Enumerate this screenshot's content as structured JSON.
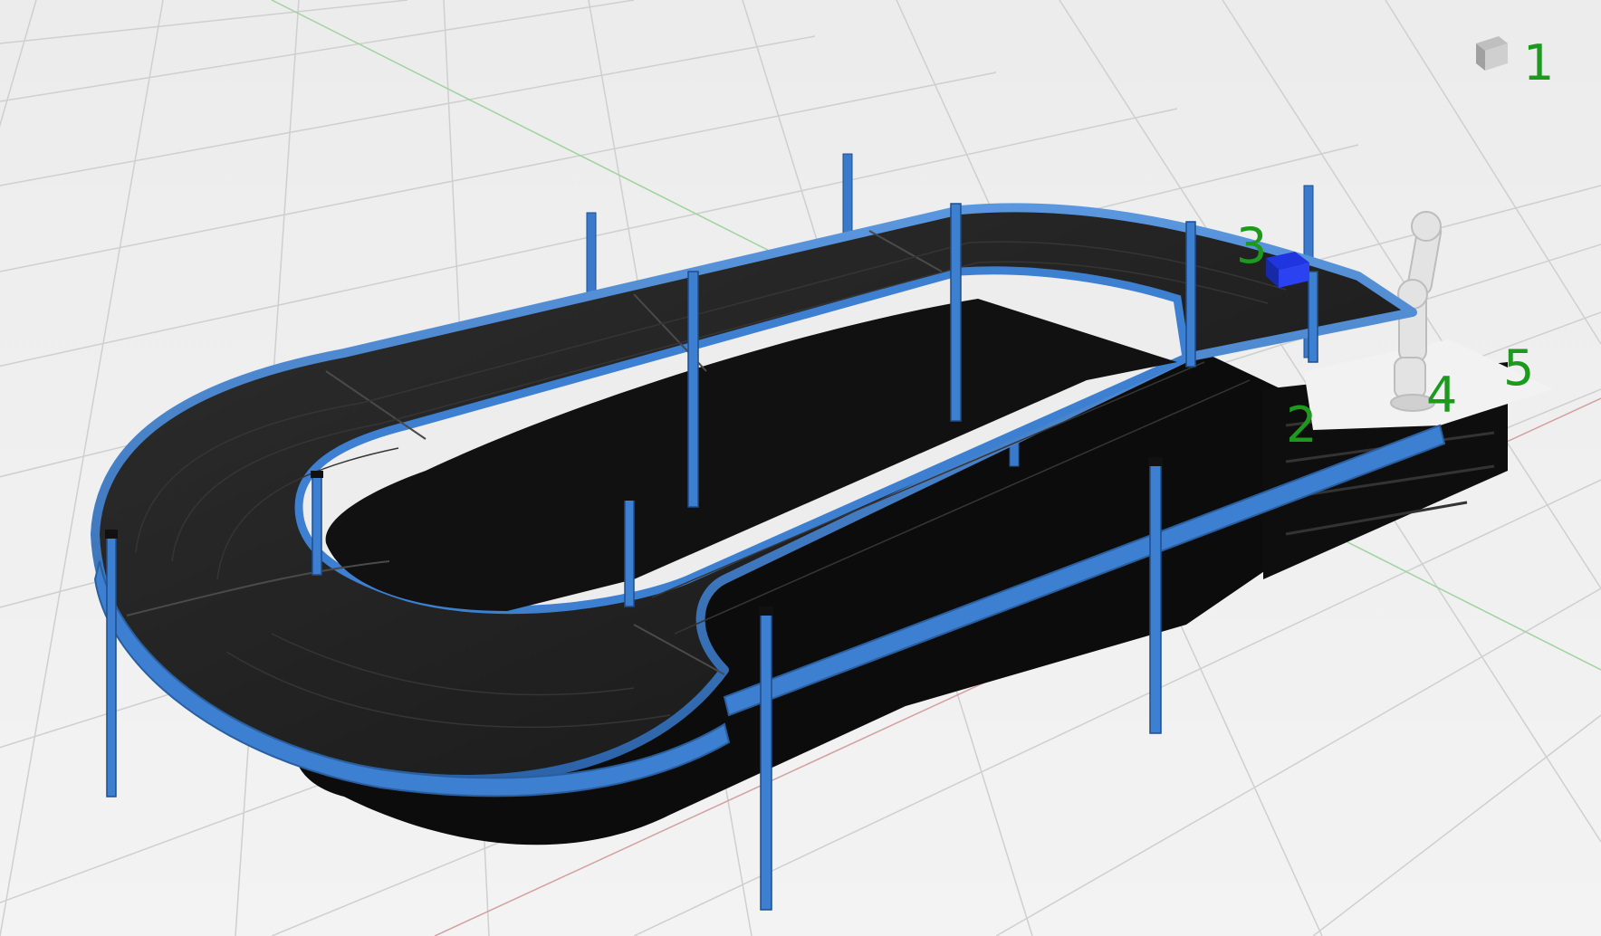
{
  "scene": {
    "description_kind": "3d-viewport",
    "markers": [
      {
        "id": "marker-1",
        "label": "1"
      },
      {
        "id": "marker-2",
        "label": "2"
      },
      {
        "id": "marker-3",
        "label": "3"
      },
      {
        "id": "marker-4",
        "label": "4"
      },
      {
        "id": "marker-5",
        "label": "5"
      }
    ],
    "colors": {
      "floor": "#e9e9e9",
      "grid": "#c9c9c9",
      "belt": "#232323",
      "frame": "#3d7fd0",
      "frame_dark": "#2a5f9f",
      "shadow": "#0b0b0b",
      "table": "#f0f0f0",
      "robot": "#e6e6e6",
      "box": "#1f35e0",
      "label": "#1d9a1d"
    }
  }
}
